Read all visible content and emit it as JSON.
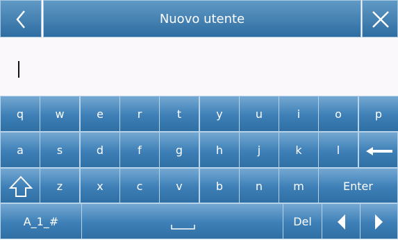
{
  "header": {
    "title": "Nuovo utente",
    "back_icon": "chevron-left-icon",
    "close_icon": "close-icon"
  },
  "input": {
    "value": ""
  },
  "keyboard": {
    "row1": [
      "q",
      "w",
      "e",
      "r",
      "t",
      "y",
      "u",
      "i",
      "o",
      "p"
    ],
    "row2": [
      "a",
      "s",
      "d",
      "f",
      "g",
      "h",
      "j",
      "k",
      "l"
    ],
    "row3": [
      "z",
      "x",
      "c",
      "v",
      "b",
      "n",
      "m"
    ],
    "enter_label": "Enter",
    "mode_label": "A_1_#",
    "del_label": "Del",
    "icons": {
      "backspace": "backspace-arrow-icon",
      "shift": "shift-arrow-icon",
      "space": "space-bar-icon",
      "left": "triangle-left-icon",
      "right": "triangle-right-icon"
    }
  },
  "colors": {
    "key_top": "#74a8d2",
    "key_bottom": "#2f6fa4",
    "field_bg": "#fbf8fb"
  }
}
